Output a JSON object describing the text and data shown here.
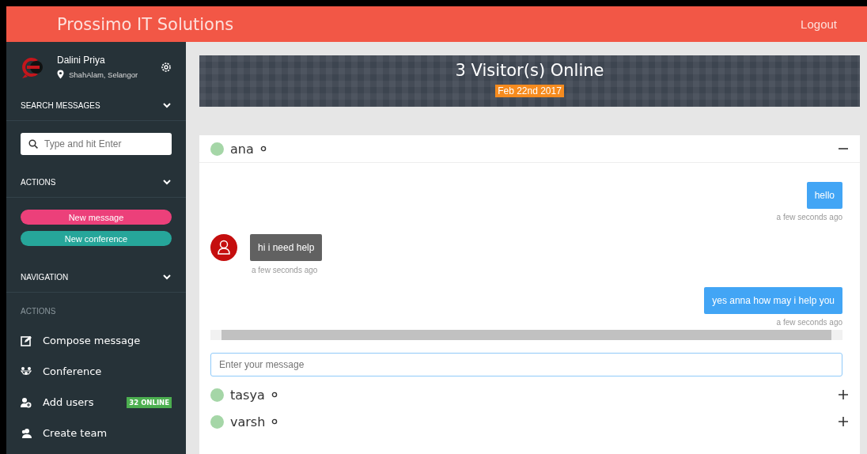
{
  "header": {
    "title": "Prossimo IT Solutions",
    "logout": "Logout"
  },
  "profile": {
    "name": "Dalini Priya",
    "location": "ShahAlam, Selangor"
  },
  "sidebar": {
    "search_section": {
      "title": "SEARCH MESSAGES",
      "expanded": true,
      "placeholder": "Type and hit Enter"
    },
    "actions_section": {
      "title": "ACTIONS",
      "expanded": true,
      "buttons": [
        {
          "label": "New message",
          "color": "#ec407a"
        },
        {
          "label": "New conference",
          "color": "#26a69a"
        }
      ]
    },
    "navigation_section": {
      "title": "NAVIGATION",
      "expanded": true,
      "subheading": "ACTIONS",
      "items": [
        {
          "label": "Compose message",
          "kind": "compose"
        },
        {
          "label": "Conference",
          "kind": "conference"
        },
        {
          "label": "Add users",
          "kind": "adduser",
          "badge": "32 ONLINE"
        },
        {
          "label": "Create team",
          "kind": "team"
        }
      ]
    }
  },
  "banner": {
    "title": "3 Visitor(s) Online",
    "date": "Feb 22nd 2017"
  },
  "chats": [
    {
      "name": "ana",
      "online": true,
      "expanded": true,
      "messages": [
        {
          "kind": "out",
          "text": "hello",
          "time": "a few seconds ago"
        },
        {
          "kind": "in",
          "text": "hi i need help",
          "time": "a few seconds ago"
        },
        {
          "kind": "out",
          "text": "yes anna how may i help you",
          "time": "a few seconds ago"
        }
      ],
      "input_placeholder": "Enter your message"
    },
    {
      "name": "tasya",
      "online": true,
      "expanded": false
    },
    {
      "name": "varsh",
      "online": true,
      "expanded": false
    }
  ]
}
